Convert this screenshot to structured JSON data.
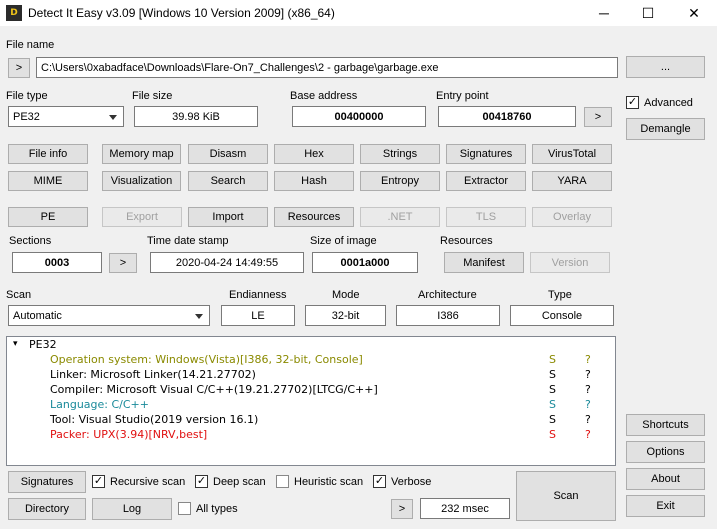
{
  "window": {
    "title": "Detect It Easy v3.09 [Windows 10 Version 2009] (x86_64)",
    "app_icon_text": "D",
    "minimize_glyph": "─",
    "maximize_glyph": "☐",
    "close_glyph": "✕"
  },
  "file_name": {
    "label": "File name",
    "browse_arrow": ">",
    "path": "C:\\Users\\0xabadface\\Downloads\\Flare-On7_Challenges\\2 - garbage\\garbage.exe",
    "more_button": "..."
  },
  "file_info": {
    "type_label": "File type",
    "type_value": "PE32",
    "size_label": "File size",
    "size_value": "39.98 KiB",
    "base_label": "Base address",
    "base_value": "00400000",
    "entry_label": "Entry point",
    "entry_value": "00418760",
    "entry_go": ">"
  },
  "right_panel": {
    "advanced_label": "Advanced",
    "advanced_checked": true,
    "demangle": "Demangle",
    "shortcuts": "Shortcuts",
    "options": "Options",
    "about": "About",
    "exit": "Exit"
  },
  "tools_row1": [
    "File info",
    "Memory map",
    "Disasm",
    "Hex",
    "Strings",
    "Signatures",
    "VirusTotal"
  ],
  "tools_row2": [
    "MIME",
    "Visualization",
    "Search",
    "Hash",
    "Entropy",
    "Extractor",
    "YARA"
  ],
  "pe_row": [
    {
      "label": "PE",
      "enabled": true
    },
    {
      "label": "Export",
      "enabled": false
    },
    {
      "label": "Import",
      "enabled": true
    },
    {
      "label": "Resources",
      "enabled": true
    },
    {
      "label": ".NET",
      "enabled": false
    },
    {
      "label": "TLS",
      "enabled": false
    },
    {
      "label": "Overlay",
      "enabled": false
    }
  ],
  "pe_info": {
    "sections_label": "Sections",
    "sections_value": "0003",
    "sections_go": ">",
    "timestamp_label": "Time date stamp",
    "timestamp_value": "2020-04-24 14:49:55",
    "image_size_label": "Size of image",
    "image_size_value": "0001a000",
    "resources_label": "Resources",
    "manifest": "Manifest",
    "version": "Version"
  },
  "scan_info": {
    "scan_label": "Scan",
    "scan_value": "Automatic",
    "endianness_label": "Endianness",
    "endianness_value": "LE",
    "mode_label": "Mode",
    "mode_value": "32-bit",
    "arch_label": "Architecture",
    "arch_value": "I386",
    "type_label": "Type",
    "type_value": "Console"
  },
  "results": {
    "root_toggle": "▾",
    "root": "PE32",
    "lines": [
      {
        "text": "Operation system: Windows(Vista)[I386, 32-bit, Console]",
        "color": "#8a8a00",
        "s": "S",
        "q": "?"
      },
      {
        "text": "Linker: Microsoft Linker(14.21.27702)",
        "color": "#000000",
        "s": "S",
        "q": "?"
      },
      {
        "text": "Compiler: Microsoft Visual C/C++(19.21.27702)[LTCG/C++]",
        "color": "#000000",
        "s": "S",
        "q": "?"
      },
      {
        "text": "Language: C/C++",
        "color": "#1a8a9a",
        "s": "S",
        "q": "?"
      },
      {
        "text": "Tool: Visual Studio(2019 version 16.1)",
        "color": "#000000",
        "s": "S",
        "q": "?"
      },
      {
        "text": "Packer: UPX(3.94)[NRV,best]",
        "color": "#e01010",
        "s": "S",
        "q": "?"
      }
    ]
  },
  "bottom": {
    "signatures": "Signatures",
    "recursive_scan": "Recursive scan",
    "recursive_checked": true,
    "deep_scan": "Deep scan",
    "deep_checked": true,
    "heuristic_scan": "Heuristic scan",
    "heuristic_checked": false,
    "verbose": "Verbose",
    "verbose_checked": true,
    "directory": "Directory",
    "log": "Log",
    "all_types": "All types",
    "all_types_checked": false,
    "next_arrow": ">",
    "time": "232 msec",
    "scan": "Scan"
  }
}
